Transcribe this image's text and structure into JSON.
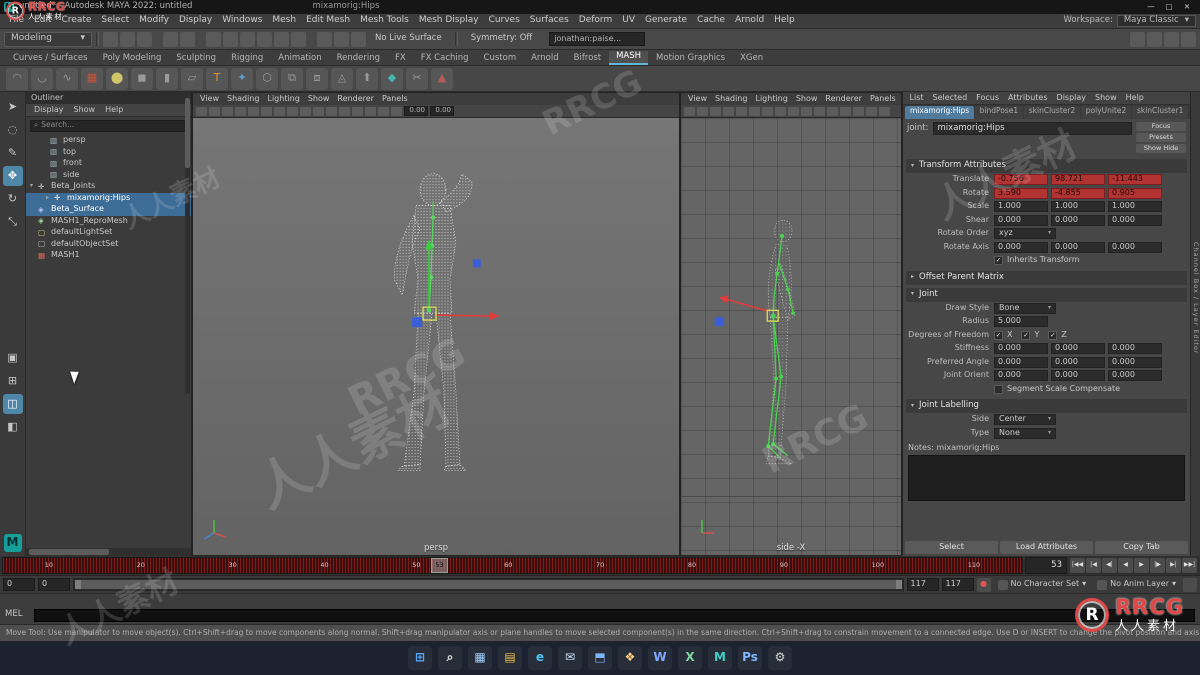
{
  "ui": {
    "maya_logo": "M",
    "dropdown_arrow": "▾",
    "arrow_down": "▾",
    "arrow_right": "▸",
    "check": "✓",
    "search_icon": "⌕"
  },
  "titlebar": {
    "title": "untitled* - Autodesk MAYA 2022: untitled",
    "selection": "mixamorig:Hips",
    "minimize": "—",
    "maximize": "▢",
    "close": "✕"
  },
  "menubar": {
    "items": [
      "File",
      "Edit",
      "Create",
      "Select",
      "Modify",
      "Display",
      "Windows",
      "Mesh",
      "Edit Mesh",
      "Mesh Tools",
      "Mesh Display",
      "Curves",
      "Surfaces",
      "Deform",
      "UV",
      "Generate",
      "Cache",
      "Arnold",
      "Help"
    ],
    "workspace_label": "Workspace:",
    "workspace_value": "Maya Classic"
  },
  "statusline": {
    "mode": "Modeling",
    "icons": [
      {
        "name": "new-scene-icon"
      },
      {
        "name": "open-scene-icon"
      },
      {
        "name": "save-scene-icon"
      },
      {
        "name": "undo-icon",
        "gap": true
      },
      {
        "name": "redo-icon"
      },
      {
        "name": "snap-to-grid-icon",
        "gap": true
      },
      {
        "name": "snap-to-curve-icon"
      },
      {
        "name": "snap-to-point-icon"
      },
      {
        "name": "snap-to-projected-center-icon"
      },
      {
        "name": "snap-to-view-plane-icon"
      },
      {
        "name": "make-live-icon"
      },
      {
        "name": "construction-history-icon",
        "gap": true
      },
      {
        "name": "render-current-frame-icon"
      },
      {
        "name": "ipr-render-icon"
      }
    ],
    "no_live_surface": "No Live Surface",
    "symmetry": "Symmetry: Off",
    "search_value": "jonathan:paise...",
    "right_icons": [
      {
        "name": "attribute-editor-toggle-icon"
      },
      {
        "name": "tool-settings-toggle-icon"
      },
      {
        "name": "channel-box-toggle-icon"
      },
      {
        "name": "modeling-toolkit-toggle-icon"
      }
    ]
  },
  "shelf": {
    "tabs": [
      {
        "label": "Curves / Surfaces"
      },
      {
        "label": "Poly Modeling"
      },
      {
        "label": "Sculpting"
      },
      {
        "label": "Rigging"
      },
      {
        "label": "Animation"
      },
      {
        "label": "Rendering"
      },
      {
        "label": "FX"
      },
      {
        "label": "FX Caching"
      },
      {
        "label": "Custom"
      },
      {
        "label": "Arnold"
      },
      {
        "label": "Bifrost"
      },
      {
        "label": "MASH",
        "active": true
      },
      {
        "label": "Motion Graphics"
      },
      {
        "label": "XGen"
      }
    ],
    "icons": [
      {
        "name": "epcurve-tool-icon",
        "glyph": "◠",
        "color": "#9a9a9a"
      },
      {
        "name": "bezier-curve-tool-icon",
        "glyph": "◡",
        "color": "#9a9a9a"
      },
      {
        "name": "pencil-curve-tool-icon",
        "glyph": "∿",
        "color": "#9a9a9a"
      },
      {
        "name": "mash-network-icon",
        "glyph": "▦",
        "color": "#c8553a"
      },
      {
        "name": "sphere-primitive-icon",
        "glyph": "⬤",
        "color": "#cfc66a"
      },
      {
        "name": "cube-primitive-icon",
        "glyph": "◼",
        "color": "#9a9a9a"
      },
      {
        "name": "cylinder-primitive-icon",
        "glyph": "▮",
        "color": "#9a9a9a"
      },
      {
        "name": "plane-primitive-icon",
        "glyph": "▱",
        "color": "#9a9a9a"
      },
      {
        "name": "type-tool-icon",
        "glyph": "T",
        "color": "#e0913f"
      },
      {
        "name": "svg-tool-icon",
        "glyph": "✦",
        "color": "#5a9fd4"
      },
      {
        "name": "boolean-union-icon",
        "glyph": "⬡",
        "color": "#9a9a9a"
      },
      {
        "name": "combine-icon",
        "glyph": "⧉",
        "color": "#9a9a9a"
      },
      {
        "name": "separate-icon",
        "glyph": "⧈",
        "color": "#9a9a9a"
      },
      {
        "name": "smooth-icon",
        "glyph": "◬",
        "color": "#9a9a9a"
      },
      {
        "name": "extrude-icon",
        "glyph": "⬆",
        "color": "#9a9a9a"
      },
      {
        "name": "bevel-icon",
        "glyph": "◆",
        "color": "#46b5ae"
      },
      {
        "name": "multi-cut-icon",
        "glyph": "✂",
        "color": "#9a9a9a"
      },
      {
        "name": "quad-draw-icon",
        "glyph": "▲",
        "color": "#b85a5a"
      }
    ]
  },
  "toolbox": {
    "tools": [
      {
        "name": "select-tool",
        "glyph": "➤"
      },
      {
        "name": "lasso-select-tool",
        "glyph": "◌"
      },
      {
        "name": "paint-select-tool",
        "glyph": "✎"
      },
      {
        "name": "move-tool",
        "glyph": "✥",
        "active": true
      },
      {
        "name": "rotate-tool",
        "glyph": "↻"
      },
      {
        "name": "scale-tool",
        "glyph": "⤡"
      }
    ],
    "layouts": [
      {
        "name": "layout-single-pane",
        "glyph": "▣"
      },
      {
        "name": "layout-four-pane",
        "glyph": "⊞"
      },
      {
        "name": "layout-two-pane-side-by-side",
        "glyph": "◫",
        "active": true
      },
      {
        "name": "layout-persp-outliner",
        "glyph": "◧"
      }
    ]
  },
  "outliner": {
    "title": "Outliner",
    "menus": [
      "Display",
      "Show",
      "Help"
    ],
    "search_placeholder": "Search...",
    "items": [
      {
        "label": "persp",
        "icon": "camera-icon",
        "glyph": "▧",
        "color": "#a7b6bf",
        "pad": "16px",
        "arrow": ""
      },
      {
        "label": "top",
        "icon": "camera-icon",
        "glyph": "▧",
        "color": "#a7b6bf",
        "pad": "16px",
        "arrow": ""
      },
      {
        "label": "front",
        "icon": "camera-icon",
        "glyph": "▧",
        "color": "#a7b6bf",
        "pad": "16px",
        "arrow": ""
      },
      {
        "label": "side",
        "icon": "camera-icon",
        "glyph": "▧",
        "color": "#a7b6bf",
        "pad": "16px",
        "arrow": ""
      },
      {
        "label": "Beta_Joints",
        "icon": "joint-icon",
        "glyph": "✛",
        "color": "#d8d8d8",
        "pad": "4px",
        "arrow": "▾"
      },
      {
        "label": "mixamorig:Hips",
        "icon": "joint-icon",
        "glyph": "✛",
        "color": "#ffffff",
        "pad": "20px",
        "arrow": "▸",
        "selected": true
      },
      {
        "label": "Beta_Surface",
        "icon": "mesh-icon",
        "glyph": "◈",
        "color": "#b9c6f2",
        "pad": "4px",
        "arrow": "",
        "selected": true
      },
      {
        "label": "MASH1_ReproMesh",
        "icon": "mesh-icon",
        "glyph": "◈",
        "color": "#a9d8a9",
        "pad": "4px",
        "arrow": ""
      },
      {
        "label": "defaultLightSet",
        "icon": "set-icon",
        "glyph": "▢",
        "color": "#ded28a",
        "pad": "4px",
        "arrow": ""
      },
      {
        "label": "defaultObjectSet",
        "icon": "set-icon",
        "glyph": "▢",
        "color": "#c4c4c4",
        "pad": "4px",
        "arrow": ""
      },
      {
        "label": "MASH1",
        "icon": "mash-node-icon",
        "glyph": "▦",
        "color": "#e06a5a",
        "pad": "4px",
        "arrow": ""
      }
    ]
  },
  "viewports": {
    "menus": [
      "View",
      "Shading",
      "Lighting",
      "Show",
      "Renderer",
      "Panels"
    ],
    "toolbar_icons": [
      {
        "name": "select-camera-icon"
      },
      {
        "name": "lock-camera-icon"
      },
      {
        "name": "camera-attributes-icon"
      },
      {
        "name": "bookmark-icon"
      },
      {
        "name": "image-plane-icon"
      },
      {
        "name": "two-d-pan-zoom-icon"
      },
      {
        "name": "isolate-select-icon"
      },
      {
        "name": "grid-toggle-icon"
      },
      {
        "name": "film-gate-icon"
      },
      {
        "name": "resolution-gate-icon"
      },
      {
        "name": "gate-mask-icon"
      },
      {
        "name": "safe-title-icon"
      },
      {
        "name": "wireframe-on-shaded-icon"
      },
      {
        "name": "xray-icon"
      },
      {
        "name": "lighting-icon"
      },
      {
        "name": "shadows-icon"
      }
    ],
    "persp": {
      "label": "persp",
      "fields": [
        "0.00",
        "0.00"
      ]
    },
    "side": {
      "label": "side -X"
    }
  },
  "attribute_editor": {
    "menus": [
      "List",
      "Selected",
      "Focus",
      "Attributes",
      "Display",
      "Show",
      "Help"
    ],
    "tabs": [
      {
        "label": "mixamorig:Hips",
        "active": true
      },
      {
        "label": "bindPose1"
      },
      {
        "label": "skinCluster2"
      },
      {
        "label": "polyUnite2"
      },
      {
        "label": "skinCluster1"
      }
    ],
    "joint_label": "joint:",
    "joint_name": "mixamorig:Hips",
    "focus_button": "Focus",
    "presets_button": "Presets",
    "show_button": "Show",
    "hide_button": "Hide",
    "transform": {
      "title": "Transform Attributes",
      "rows": [
        {
          "label": "Translate",
          "values": [
            "-0.756",
            "98.721",
            "-11.443"
          ],
          "keyed": true
        },
        {
          "label": "Rotate",
          "values": [
            "3.590",
            "-4.855",
            "0.905"
          ],
          "keyed": true
        },
        {
          "label": "Scale",
          "values": [
            "1.000",
            "1.000",
            "1.000"
          ]
        },
        {
          "label": "Shear",
          "values": [
            "0.000",
            "0.000",
            "0.000"
          ]
        }
      ],
      "rotate_order_label": "Rotate Order",
      "rotate_order": "xyz",
      "rotate_axis_label": "Rotate Axis",
      "rotate_axis": [
        "0.000",
        "0.000",
        "0.000"
      ],
      "inherits_label": "Inherits Transform"
    },
    "offset_title": "Offset Parent Matrix",
    "joint": {
      "title": "Joint",
      "draw_style_label": "Draw Style",
      "draw_style": "Bone",
      "radius_label": "Radius",
      "radius": "5.000",
      "dof_label": "Degrees of Freedom",
      "dof": [
        "X",
        "Y",
        "Z"
      ],
      "rows": [
        {
          "label": "Stiffness",
          "values": [
            "0.000",
            "0.000",
            "0.000"
          ]
        },
        {
          "label": "Preferred Angle",
          "values": [
            "0.000",
            "0.000",
            "0.000"
          ]
        },
        {
          "label": "Joint Orient",
          "values": [
            "0.000",
            "0.000",
            "0.000"
          ]
        }
      ],
      "segment_label": "Segment Scale Compensate"
    },
    "labelling": {
      "title": "Joint Labelling",
      "side_label": "Side",
      "side": "Center",
      "type_label": "Type",
      "type": "None"
    },
    "notes_label": "Notes: mixamorig:Hips",
    "footer": [
      "Select",
      "Load Attributes",
      "Copy Tab"
    ],
    "side_tab": "Channel Box / Layer Editor"
  },
  "timeline": {
    "labels": [
      "10",
      "20",
      "30",
      "40",
      "50",
      "60",
      "70",
      "80",
      "90",
      "100",
      "110"
    ],
    "current_frame": "53",
    "transport": [
      {
        "name": "go-to-start-button",
        "glyph": "|◀◀"
      },
      {
        "name": "step-back-frame-button",
        "glyph": "|◀"
      },
      {
        "name": "step-back-key-button",
        "glyph": "◀|"
      },
      {
        "name": "play-backwards-button",
        "glyph": "◀"
      },
      {
        "name": "play-forwards-button",
        "glyph": "▶"
      },
      {
        "name": "step-forward-key-button",
        "glyph": "|▶"
      },
      {
        "name": "step-forward-frame-button",
        "glyph": "▶|"
      },
      {
        "name": "go-to-end-button",
        "glyph": "▶▶|"
      }
    ]
  },
  "range": {
    "start": "0",
    "anim_start": "0",
    "anim_end": "117",
    "end": "117",
    "character_set": "No Character Set",
    "anim_layer": "No Anim Layer",
    "auto_key": "●"
  },
  "mel": {
    "label": "MEL",
    "value": ""
  },
  "help": {
    "text": "Move Tool: Use manipulator to move object(s). Ctrl+Shift+drag to move components along normal. Shift+drag manipulator axis or plane handles to move selected component(s) in the same direction. Ctrl+Shift+drag to constrain movement to a connected edge. Use D or INSERT to change the pivot position and axis orientation."
  },
  "taskbar": {
    "icons": [
      {
        "name": "windows-start-icon",
        "glyph": "⊞",
        "color": "#57a8ff"
      },
      {
        "name": "search-icon",
        "glyph": "⌕",
        "color": "#e8e8e8"
      },
      {
        "name": "task-view-icon",
        "glyph": "▦",
        "color": "#9fd0ff"
      },
      {
        "name": "file-explorer-icon",
        "glyph": "▤",
        "color": "#f0c04a"
      },
      {
        "name": "edge-browser-icon",
        "glyph": "e",
        "color": "#4fc3f7"
      },
      {
        "name": "mail-icon",
        "glyph": "✉",
        "color": "#cfe3ff"
      },
      {
        "name": "store-icon",
        "glyph": "⬒",
        "color": "#7fb7ff"
      },
      {
        "name": "photos-icon",
        "glyph": "❖",
        "color": "#ffd27f"
      },
      {
        "name": "word-icon",
        "glyph": "W",
        "color": "#7fa8ff"
      },
      {
        "name": "excel-icon",
        "glyph": "X",
        "color": "#7fd89f"
      },
      {
        "name": "maya-icon",
        "glyph": "M",
        "color": "#3fd0c9"
      },
      {
        "name": "photoshop-icon",
        "glyph": "Ps",
        "color": "#7fb4ff"
      },
      {
        "name": "settings-icon",
        "glyph": "⚙",
        "color": "#d8d8d8"
      }
    ]
  },
  "watermarks": {
    "tiles": [
      "人人素材",
      "RRCG",
      "RRCG",
      "人人素材",
      "人人素材",
      "RRCG",
      "人人素材"
    ]
  },
  "logos": {
    "letter": "R",
    "brand": "RRCG",
    "brand_cn": "人人素材"
  }
}
